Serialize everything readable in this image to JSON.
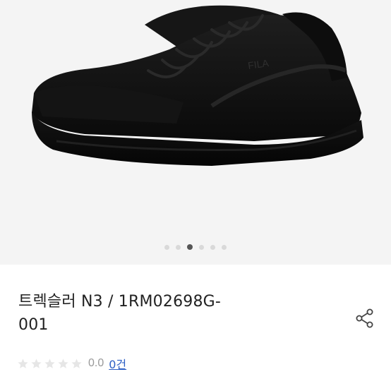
{
  "product": {
    "image_alt": "black sneaker",
    "title_line1": "트렉슬러 N3 / 1RM02698G-",
    "title_line2": "001",
    "brand_mark": "FILA"
  },
  "carousel": {
    "total": 6,
    "active_index": 2
  },
  "rating": {
    "value": "0.0",
    "max_stars": 5,
    "filled_stars": 0,
    "review_count": "0건"
  },
  "icons": {
    "share": "share-icon",
    "star": "star-icon"
  },
  "colors": {
    "link": "#2c5ec4",
    "star_empty": "#e6e6e6",
    "dot_active": "#555555",
    "dot_inactive": "#d9d9d9"
  }
}
